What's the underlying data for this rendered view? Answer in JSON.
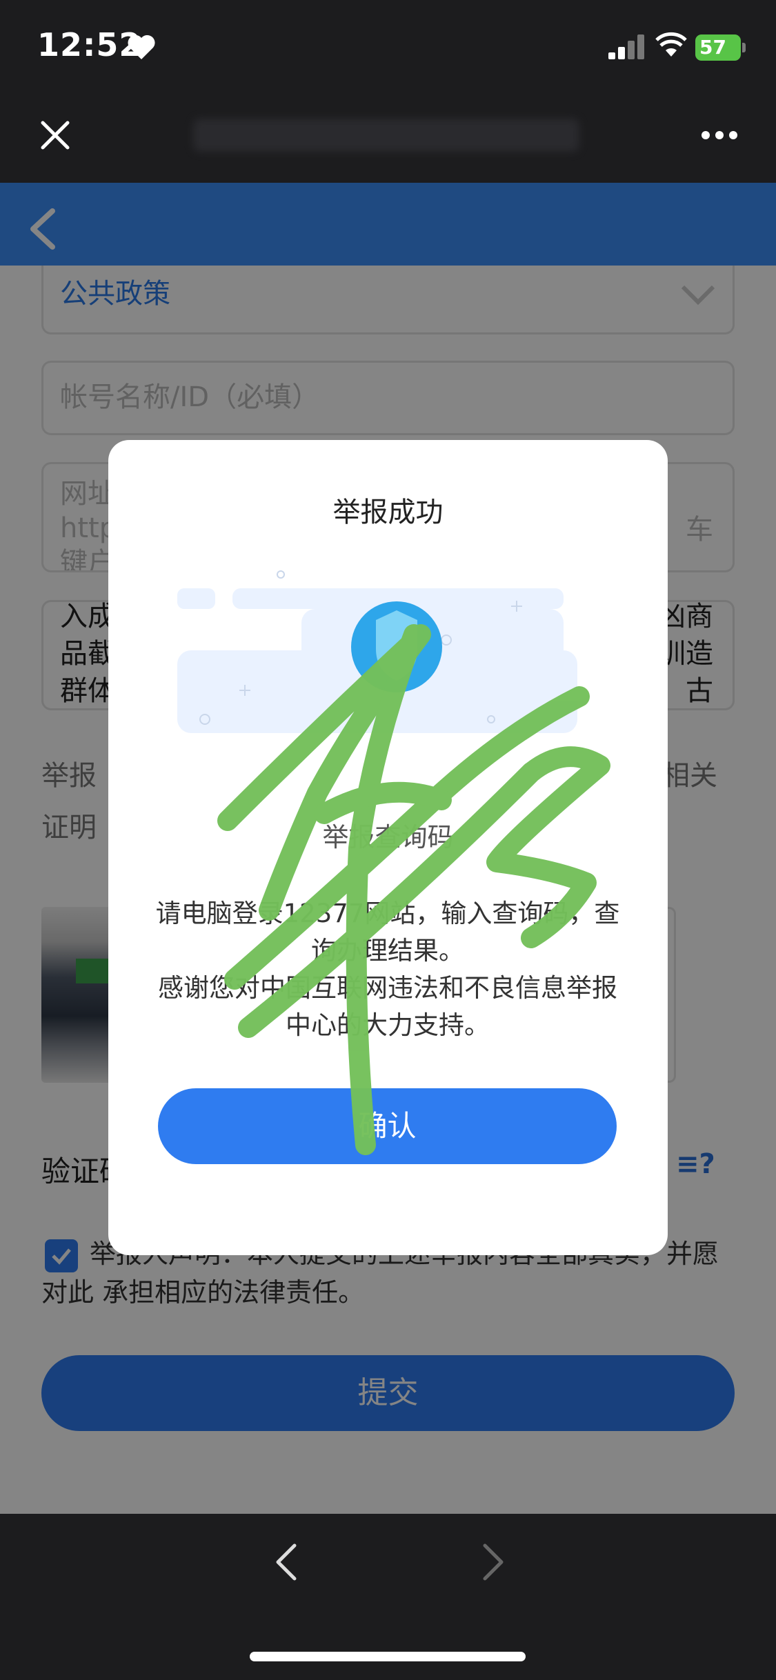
{
  "status_bar": {
    "time": "12:52",
    "battery": "57"
  },
  "form": {
    "category_value": "公共政策",
    "account_placeholder": "帐号名称/ID（必填）",
    "url_placeholder_line1": "网址",
    "url_placeholder_line2": "http",
    "url_placeholder_line3": "键户",
    "url_right_fragment": "车",
    "desc_line1_left": "入成",
    "desc_line1_right": "凶商",
    "desc_line2_left": "品截",
    "desc_line2_right": "训造",
    "desc_line3_left": "群体",
    "desc_line3_right": "古",
    "evidence_left_line1": "举报",
    "evidence_right_line1": "相关",
    "evidence_left_line2": "证明",
    "captcha_label": "验证码",
    "declaration": "举报人声明：本人提交的上述举报内容全部真实，并愿对此 承担相应的法律责任。",
    "submit_label": "提交"
  },
  "modal": {
    "title": "举报成功",
    "query_label": "举报查询码",
    "message_line1": "请电脑登录12377网站，输入查询码，查询办理结果。",
    "message_line2": "感谢您对中国互联网违法和不良信息举报中心的大力支持。",
    "confirm_label": "确认"
  },
  "colors": {
    "accent": "#2f7cf0",
    "nav": "#3d8ef7",
    "scribble": "#74c05a"
  }
}
